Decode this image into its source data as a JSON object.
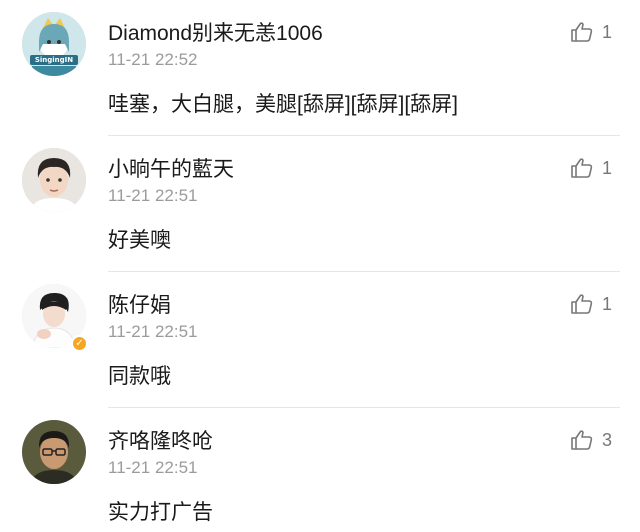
{
  "comments": [
    {
      "username": "Diamond别来无恙1006",
      "time": "11-21 22:52",
      "text": "哇塞，大白腿，美腿[舔屏][舔屏][舔屏]",
      "likes": "1",
      "avatar_icon": "avatar-anime-girl-icon",
      "avatar_text": "SingingIN"
    },
    {
      "username": "小晌午的藍天",
      "time": "11-21 22:51",
      "text": "好美噢",
      "likes": "1",
      "avatar_icon": "avatar-young-man-icon"
    },
    {
      "username": "陈仔娟",
      "time": "11-21 22:51",
      "text": "同款哦",
      "likes": "1",
      "avatar_icon": "avatar-woman-icon",
      "verified": true,
      "verified_color": "#f5a623"
    },
    {
      "username": "齐咯隆咚呛",
      "time": "11-21 22:51",
      "text": "实力打广告",
      "likes": "3",
      "avatar_icon": "avatar-glasses-man-icon"
    }
  ]
}
